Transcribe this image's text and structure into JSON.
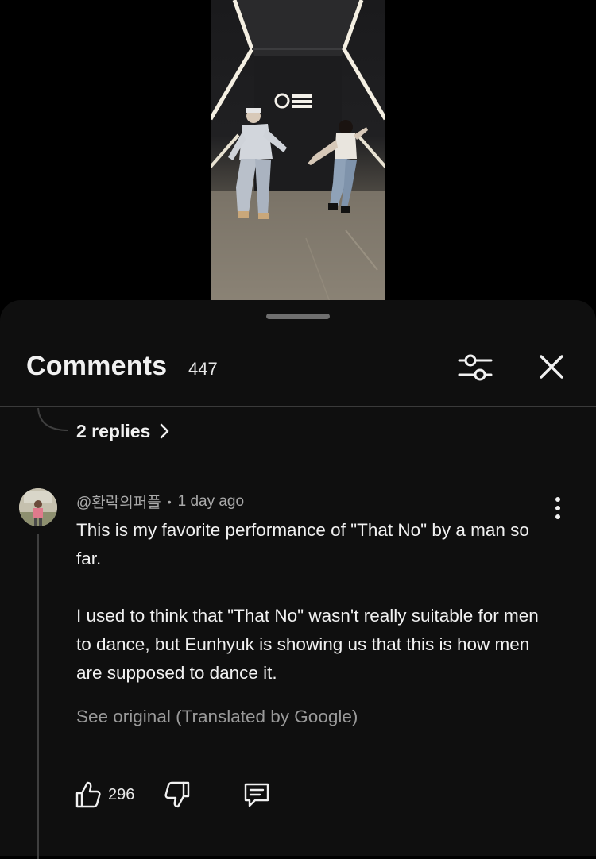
{
  "comments_panel": {
    "title": "Comments",
    "count": "447"
  },
  "replies_link": {
    "label": "2 replies"
  },
  "comment": {
    "author": "@환락의퍼플",
    "separator": "•",
    "time": "1 day ago",
    "paragraphs": [
      "This is my favorite performance of \"That No\" by a man so far.",
      "I used to think that \"That No\" wasn't really suitable for men to dance, but Eunhyuk is showing us that this is how men are supposed to dance it."
    ],
    "see_original": "See original (Translated by Google)",
    "likes": "296"
  },
  "icons": {
    "filter": "sliders-icon",
    "close": "close-icon",
    "more": "more-vertical-icon",
    "like": "thumbs-up-icon",
    "dislike": "thumbs-down-icon",
    "reply": "reply-comment-icon",
    "chevron": "chevron-right-icon"
  },
  "colors": {
    "sheet_background": "#0f0f0f",
    "text_primary": "#f1f1f1",
    "text_secondary": "#aaaaaa"
  }
}
